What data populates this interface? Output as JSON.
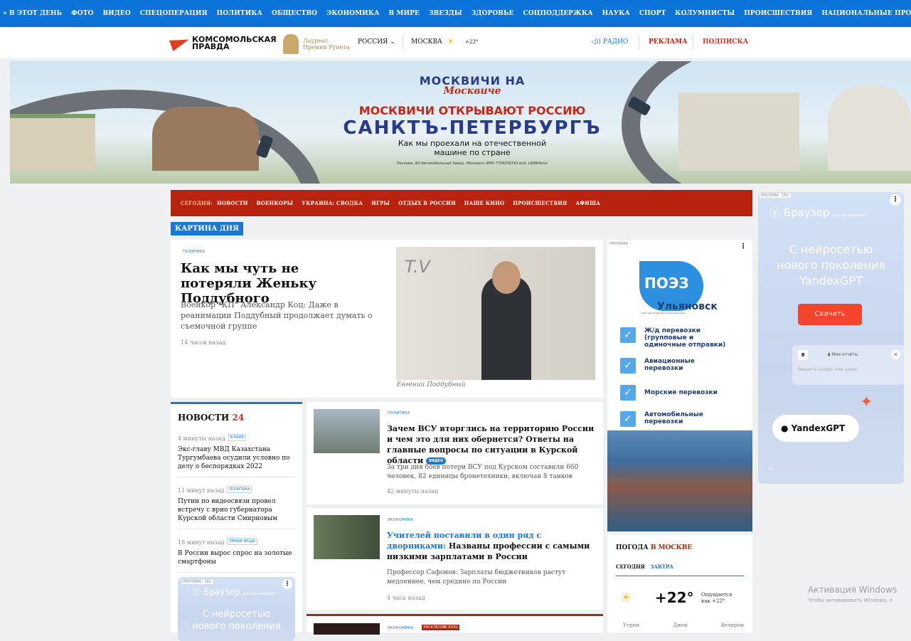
{
  "topnav": [
    "» В ЭТОТ ДЕНЬ",
    "ФОТО",
    "ВИДЕО",
    "СПЕЦОПЕРАЦИЯ",
    "ПОЛИТИКА",
    "ОБЩЕСТВО",
    "ЭКОНОМИКА",
    "В МИРЕ",
    "ЗВЕЗДЫ",
    "ЗДОРОВЬЕ",
    "СОЦПОДДЕРЖКА",
    "НАУКА",
    "СПОРТ",
    "КОЛУМНИСТЫ",
    "ПРОИСШЕСТВИЯ",
    "НАЦИОНАЛЬНЫЕ ПРОЕКТЫ РОССИИ"
  ],
  "header": {
    "logo_line1": "КОМСОМОЛЬСКАЯ",
    "logo_line2": "ПРАВДА",
    "laureate_line1": "Лауреат",
    "laureate_line2": "Премии Рунета",
    "region": "РОССИЯ",
    "city": "МОСКВА",
    "temp": "+22°",
    "radio": "РАДИО",
    "ads": "РЕКЛАМА",
    "subscribe": "ПОДПИСКА"
  },
  "banner": {
    "top": "МОСКВИЧИ НА",
    "script": "Москвиче",
    "line1": "МОСКВИЧИ ОТКРЫВАЮТ РОССИЮ",
    "line2": "САНКТЪ-ПЕТЕРБУРГЪ",
    "line3a": "Как мы проехали на отечественной",
    "line3b": "машине по стране",
    "legal": "Реклама. АО Автомобильный Завод «Москвич» ИНН 7709259743 erid: LjN8K4mui"
  },
  "rubrics": {
    "today": "СЕГОДНЯ:",
    "items": [
      "НОВОСТИ",
      "ВОЕНКОРЫ",
      "УКРАИНА: СВОДКА",
      "ИГРЫ",
      "ОТДЫХ В РОССИИ",
      "НАШЕ КИНО",
      "ПРОИСШЕСТВИЯ",
      "АФИША"
    ]
  },
  "kartina": "КАРТИНА ДНЯ",
  "main_story": {
    "tag": "ПОЛИТИКА",
    "title": "Как мы чуть не потеряли Женьку Поддубного",
    "lead": "Военкор \"КП\" Александр Коц: Даже в реанимации Поддубный продолжает думать о съемочной группе",
    "ago": "14 часов назад",
    "caption": "Евгений Поддубный"
  },
  "news": {
    "title": "НОВОСТИ",
    "count": "24",
    "items": [
      {
        "ago": "4 минуты назад",
        "tag": "В МИРЕ",
        "text": "Экс-главу МВД Казахстана Тургумбаева осудили условно по делу о беспорядках 2022"
      },
      {
        "ago": "11 минут назад",
        "tag": "ПОЛИТИКА",
        "text": "Путин по видеосвязи провел встречу с врио губернатора Курской области Смирновым"
      },
      {
        "ago": "18 минут назад",
        "tag": "УМНЫЕ ВЕЩИ",
        "text": "В России вырос спрос на золотые смартфоны"
      }
    ]
  },
  "stories": [
    {
      "tag": "ПОЛИТИКА",
      "title": "Зачем ВСУ вторглись на территорию России и чем это для них обернется? Ответы на главные вопросы по ситуации в Курской области",
      "badge": "ВИДЕО",
      "lead": "За три дня боев потери ВСУ под Курском составили 660 человек, 82 единицы бронетехники, включая 8 танков",
      "ago": "42 минуты назад"
    },
    {
      "tag": "ЭКОНОМИКА",
      "title_a": "Учителей поставили в один ряд с дворниками:",
      "title_b": "Названы профессии с самыми низкими зарплатами в России",
      "lead": "Профессор Сафонов: Зарплаты бюджетников растут медленнее, чем средние по России",
      "ago": "4 часа назад"
    },
    {
      "tag": "ЭКОНОМИКА",
      "tag2": "ЭКСКЛЮЗИВ KP.RU"
    }
  ],
  "ad_poez": {
    "label": "РЕКЛАМА",
    "logo": "ПОЭЗ",
    "city": "Ульяновск",
    "sub": "Портовая Особая Экономическая Зона",
    "items": [
      "Ж/д перевозки (групповые и одиночные отправки)",
      "Авиационные перевозки",
      "Морские перевозки",
      "Автомобильные перевозки"
    ]
  },
  "weather": {
    "title_a": "ПОГОДА",
    "title_b": "В МОСКВЕ",
    "tab_today": "СЕГОДНЯ",
    "tab_tomorrow": "ЗАВТРА",
    "temp": "+22°",
    "feels_a": "Ощущается",
    "feels_b": "как +22°",
    "parts": [
      "Утром",
      "Днем",
      "Вечером"
    ]
  },
  "yandex_ad": {
    "label": "РЕКЛАМА · 18+",
    "brand": "Браузер",
    "org": "для организаций",
    "head_a": "С нейросетью",
    "head_b": "нового поколения",
    "head_c": "YandexGPT",
    "btn": "Скачать",
    "tab_num": "8",
    "tab_text": "Мои отчёты",
    "placeholder": "Введите запрос или адрес",
    "pill": "YandexGPT",
    "age": "0+"
  },
  "yandex_small": {
    "label": "РЕКЛАМА · 18+",
    "brand": "Браузер",
    "org": "для организаций",
    "head_a": "С нейросетью",
    "head_b": "нового поколения"
  },
  "windows": {
    "line1": "Активация Windows",
    "line2": "Чтобы активировать Windows, п"
  }
}
